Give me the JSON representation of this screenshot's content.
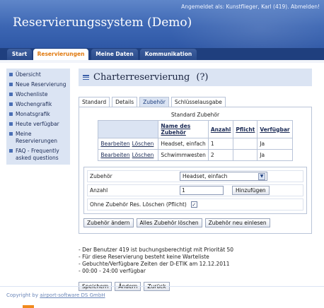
{
  "header": {
    "login_info": "Angemeldet als: Kunstflieger, Karl (419). Abmelden!",
    "title": "Reservierungssystem (Demo)"
  },
  "nav": {
    "tabs": [
      "Start",
      "Reservierungen",
      "Meine Daten",
      "Kommunikation"
    ],
    "active": "Reservierungen"
  },
  "sidebar": {
    "items": [
      {
        "label": "Übersicht"
      },
      {
        "label": "Neue Reservierung"
      },
      {
        "label": "Wochenliste"
      },
      {
        "label": "Wochengrafik"
      },
      {
        "label": "Monatsgrafik"
      },
      {
        "label": "Heute verfügbar"
      },
      {
        "label": "Meine Reservierungen"
      },
      {
        "label": "FAQ - Frequently asked questions"
      }
    ]
  },
  "main": {
    "title": "Charterreservierung",
    "help": "(?)",
    "tabs": [
      "Standard",
      "Details",
      "Zubehör",
      "Schlüsselausgabe"
    ],
    "active_tab": "Zubehör"
  },
  "accessories_table": {
    "caption": "Standard Zubehör",
    "columns": [
      "Name des Zubehör",
      "Anzahl",
      "Pflicht",
      "Verfügbar"
    ],
    "actions": {
      "edit": "Bearbeiten",
      "delete": "Löschen"
    },
    "rows": [
      {
        "name": "Headset, einfach",
        "count": "1",
        "required": "",
        "available": "Ja"
      },
      {
        "name": "Schwimmwesten",
        "count": "2",
        "required": "",
        "available": "Ja"
      }
    ]
  },
  "form": {
    "accessory_label": "Zubehör",
    "accessory_selected": "Headset, einfach",
    "count_label": "Anzahl",
    "count_value": "1",
    "add_button": "Hinzufügen",
    "delete_check_label": "Ohne Zubehör Res. Löschen (Pflicht)",
    "delete_checked": true
  },
  "action_buttons": [
    "Zubehör ändern",
    "Alles Zubehör löschen",
    "Zubehör neu einlesen"
  ],
  "info": [
    "- Der Benutzer 419 ist buchungsberechtigt mit Priorität 50",
    "- Für diese Reservierung besteht keine Warteliste",
    "- Gebuchte/Verfügbare Zeiten der D-ETIK am 12.12.2011",
    "- 00:00 - 24:00 verfügbar"
  ],
  "bottom_buttons": [
    "Speichern",
    "Ändern",
    "Zurück"
  ],
  "footer": {
    "prefix": "Copyright by ",
    "link": "airport-software DS GmbH"
  },
  "colors": {
    "header_blue": "#3c66b3",
    "nav_dark": "#1f3f7e",
    "active_orange": "#e07a10",
    "panel_light": "#dbe4f3"
  }
}
